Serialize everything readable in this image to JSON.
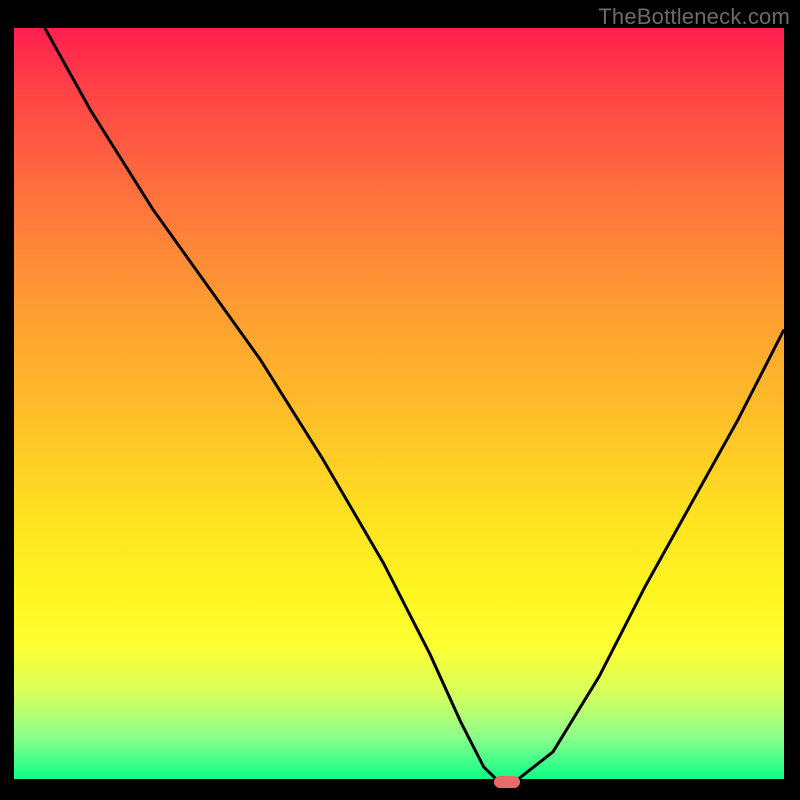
{
  "watermark": "TheBottleneck.com",
  "colors": {
    "curve_stroke": "#000000",
    "background": "#000000",
    "marker_fill": "#ea6a69",
    "watermark_text": "#6a6a6a"
  },
  "chart_data": {
    "type": "line",
    "title": "",
    "xlabel": "",
    "ylabel": "",
    "xlim": [
      0,
      100
    ],
    "ylim": [
      0,
      100
    ],
    "curve": {
      "x": [
        4,
        10,
        18,
        25,
        32,
        40,
        48,
        54,
        58,
        61,
        63,
        65,
        70,
        76,
        82,
        88,
        94,
        100
      ],
      "y": [
        100,
        89,
        76,
        66,
        56,
        43,
        29,
        17,
        8,
        2,
        0,
        0,
        4,
        14,
        26,
        37,
        48,
        60
      ]
    },
    "marker": {
      "x": 64,
      "y": 0
    },
    "gradient_stops": [
      {
        "pct": 0,
        "hex": "#ff1f4e"
      },
      {
        "pct": 8,
        "hex": "#ff4246"
      },
      {
        "pct": 22,
        "hex": "#ff713d"
      },
      {
        "pct": 36,
        "hex": "#ff9a32"
      },
      {
        "pct": 52,
        "hex": "#ffc028"
      },
      {
        "pct": 64,
        "hex": "#ffe021"
      },
      {
        "pct": 74,
        "hex": "#fff41f"
      },
      {
        "pct": 82,
        "hex": "#fdff33"
      },
      {
        "pct": 88,
        "hex": "#d9ff5b"
      },
      {
        "pct": 94,
        "hex": "#8dff8b"
      },
      {
        "pct": 100,
        "hex": "#04ff88"
      }
    ]
  }
}
